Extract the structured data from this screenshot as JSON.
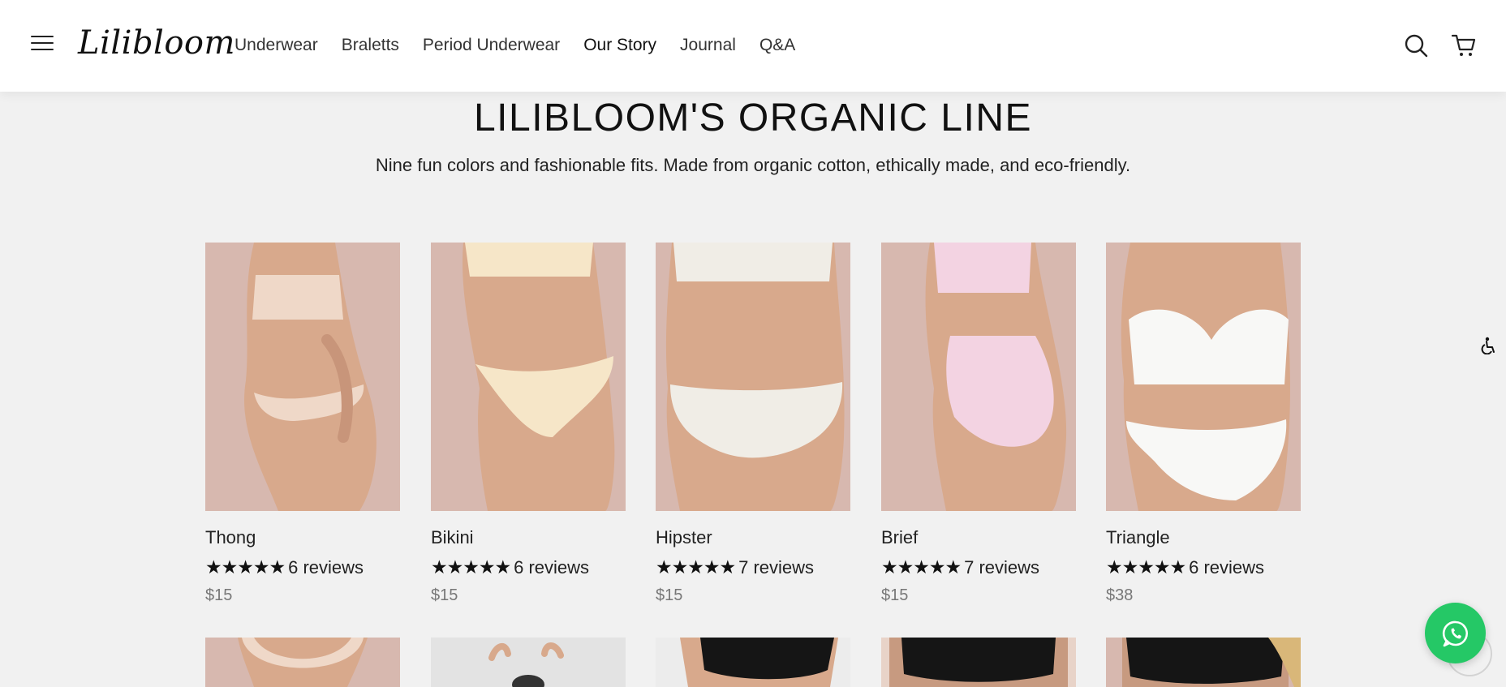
{
  "header": {
    "logo": "Lilibloom",
    "nav": [
      "Underwear",
      "Braletts",
      "Period Underwear",
      "Our Story",
      "Journal",
      "Q&A"
    ],
    "icons": [
      "menu-icon",
      "search-icon",
      "cart-icon"
    ]
  },
  "hero": {
    "title": "LILIBLOOM'S ORGANIC LINE",
    "subtitle": "Nine fun colors and fashionable fits. Made from organic cotton, ethically made, and eco-friendly."
  },
  "products": [
    {
      "name": "Thong",
      "stars": "★★★★★",
      "reviews": "6 reviews",
      "price": "$15",
      "garment_color": "#efd8c8"
    },
    {
      "name": "Bikini",
      "stars": "★★★★★",
      "reviews": "6 reviews",
      "price": "$15",
      "garment_color": "#f6e6c8"
    },
    {
      "name": "Hipster",
      "stars": "★★★★★",
      "reviews": "7 reviews",
      "price": "$15",
      "garment_color": "#f0ede6"
    },
    {
      "name": "Brief",
      "stars": "★★★★★",
      "reviews": "7 reviews",
      "price": "$15",
      "garment_color": "#f3d3e2"
    },
    {
      "name": "Triangle",
      "stars": "★★★★★",
      "reviews": "6 reviews",
      "price": "$38",
      "garment_color": "#f8f8f6"
    }
  ],
  "colors": {
    "background": "#f1f1f1",
    "image_background": "#d7b8af",
    "skin": "#d8a98c",
    "whatsapp": "#25c866",
    "price": "#777777"
  },
  "widgets": [
    "accessibility-icon",
    "whatsapp-icon"
  ]
}
